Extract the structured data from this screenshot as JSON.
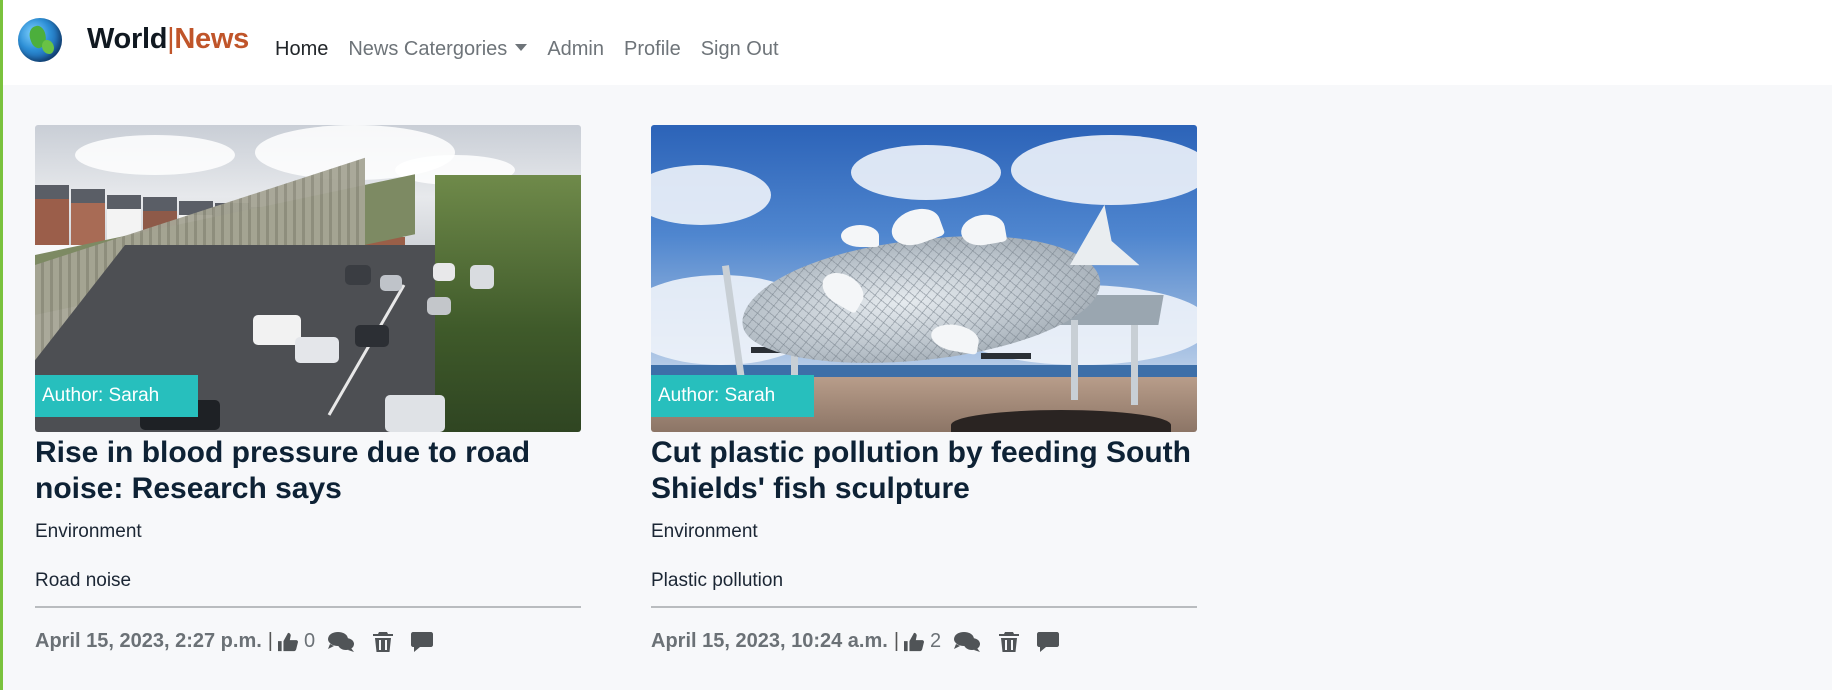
{
  "brand": {
    "part1": "World",
    "separator": "|",
    "part2": "News"
  },
  "nav": {
    "items": [
      {
        "label": "Home",
        "active": true
      },
      {
        "label": "News Catergories",
        "dropdown": true
      },
      {
        "label": "Admin"
      },
      {
        "label": "Profile"
      },
      {
        "label": "Sign Out"
      }
    ]
  },
  "colors": {
    "accent": "#27bfbd",
    "brand_red": "#c0552a",
    "left_bar": "#7ac23d"
  },
  "articles": [
    {
      "image": "road-traffic-photo",
      "author": "Author: Sarah",
      "title": "Rise in blood pressure due to road noise: Research says",
      "category": "Environment",
      "subtitle": "Road noise",
      "date": "April 15, 2023, 2:27 p.m.",
      "separator": "|",
      "likes": "0"
    },
    {
      "image": "fish-sculpture-photo",
      "author": "Author: Sarah",
      "title": "Cut plastic pollution by feeding South Shields' fish sculpture",
      "category": "Environment",
      "subtitle": "Plastic pollution",
      "date": "April 15, 2023, 10:24 a.m.",
      "separator": "|",
      "likes": "2"
    }
  ]
}
